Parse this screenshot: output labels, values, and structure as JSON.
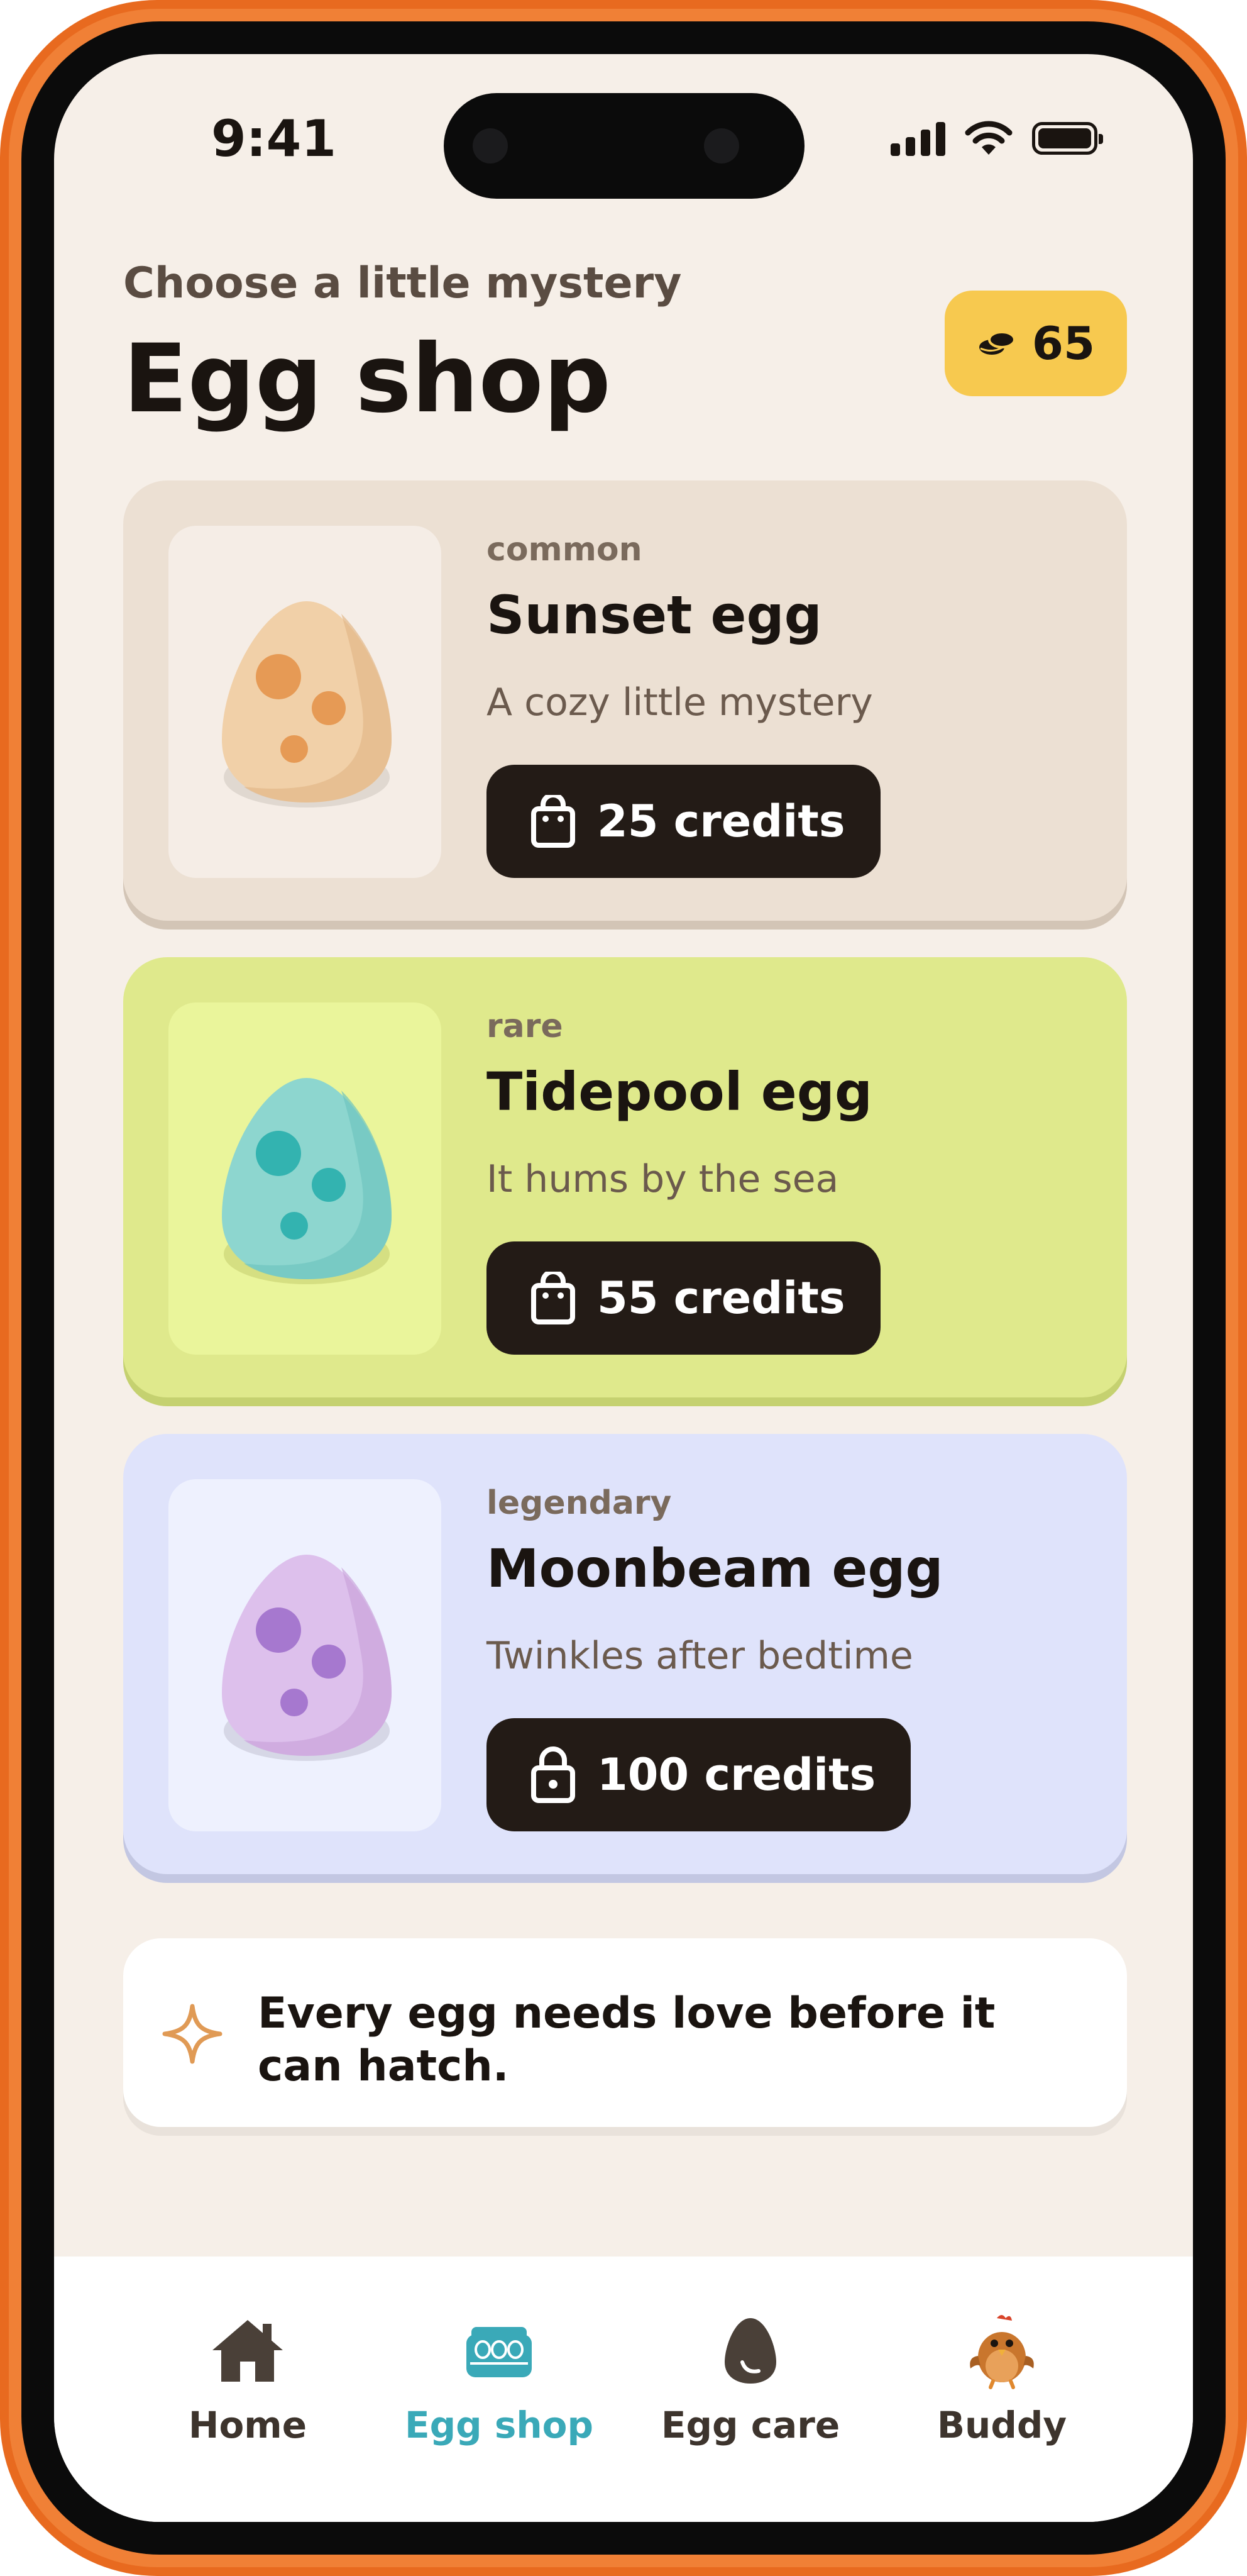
{
  "status_bar": {
    "time": "9:41"
  },
  "header": {
    "subtitle": "Choose a little mystery",
    "title": "Egg shop",
    "balance": "65"
  },
  "eggs": [
    {
      "tier": "common",
      "name": "Sunset egg",
      "description": "A cozy little mystery",
      "price_label": "25 credits",
      "action_icon": "shopping-bag-icon",
      "colors": {
        "card": "#ece0d3",
        "box": "#f5ede6",
        "egg": "#f1d0a8",
        "spots": "#e69a55"
      }
    },
    {
      "tier": "rare",
      "name": "Tidepool egg",
      "description": "It hums by the sea",
      "price_label": "55 credits",
      "action_icon": "shopping-bag-icon",
      "colors": {
        "card": "#dfe98c",
        "box": "#eaf59b",
        "egg": "#8dd6cf",
        "spots": "#33b3b0"
      }
    },
    {
      "tier": "legendary",
      "name": "Moonbeam egg",
      "description": "Twinkles after bedtime",
      "price_label": "100 credits",
      "action_icon": "lock-icon",
      "colors": {
        "card": "#dfe3fb",
        "box": "#eef1fe",
        "egg": "#ddc0ec",
        "spots": "#a678cf"
      }
    }
  ],
  "tip": {
    "text": "Every egg needs love before it can hatch.",
    "icon": "sparkle-icon"
  },
  "tabs": [
    {
      "label": "Home",
      "icon": "home-icon"
    },
    {
      "label": "Egg shop",
      "icon": "egg-carton-icon",
      "active": true
    },
    {
      "label": "Egg care",
      "icon": "egg-icon"
    },
    {
      "label": "Buddy",
      "icon": "chick-icon"
    }
  ],
  "colors": {
    "accent": "#3aa9b8",
    "pill": "#f7c94f",
    "frame": "#e86a1f",
    "dark": "#231b16"
  }
}
